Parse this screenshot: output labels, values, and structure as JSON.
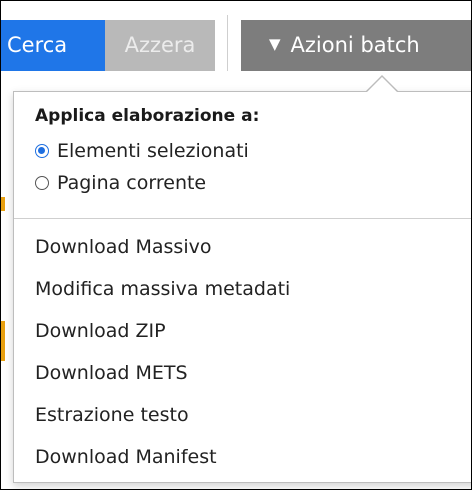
{
  "toolbar": {
    "search_label": "Cerca",
    "reset_label": "Azzera",
    "batch_label": "Azioni batch",
    "caret_icon": "caret-down-icon",
    "colors": {
      "search_bg": "#1f76e8",
      "reset_bg": "#b9b9b9",
      "batch_bg": "#7d7d7d"
    }
  },
  "dropdown": {
    "apply_heading": "Applica elaborazione a:",
    "scope_options": [
      {
        "label": "Elementi selezionati",
        "selected": true
      },
      {
        "label": "Pagina corrente",
        "selected": false
      }
    ],
    "actions": [
      {
        "label": "Download Massivo"
      },
      {
        "label": "Modifica massiva metadati"
      },
      {
        "label": "Download ZIP"
      },
      {
        "label": "Download METS"
      },
      {
        "label": "Estrazione testo"
      },
      {
        "label": "Download Manifest"
      }
    ]
  }
}
